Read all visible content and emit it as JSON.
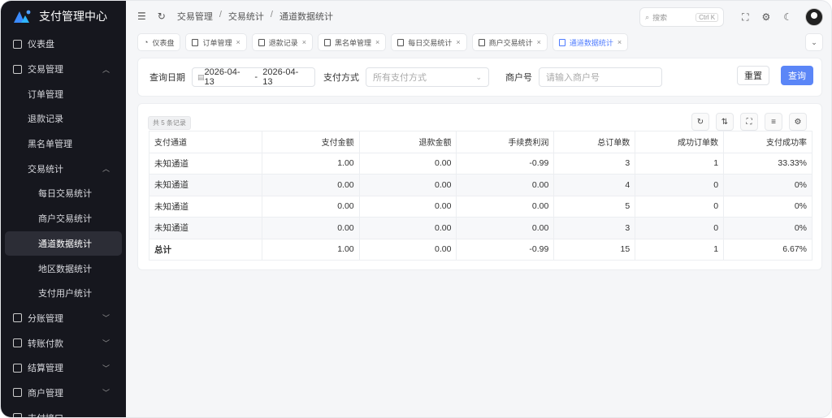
{
  "app": {
    "title": "支付管理中心"
  },
  "sidebar": {
    "items": [
      {
        "label": "仪表盘",
        "level": 1
      },
      {
        "label": "交易管理",
        "level": 1,
        "chev": "^"
      },
      {
        "label": "订单管理",
        "level": 2
      },
      {
        "label": "退款记录",
        "level": 2
      },
      {
        "label": "黑名单管理",
        "level": 2
      },
      {
        "label": "交易统计",
        "level": 2,
        "chev": "^"
      },
      {
        "label": "每日交易统计",
        "level": 3
      },
      {
        "label": "商户交易统计",
        "level": 3
      },
      {
        "label": "通道数据统计",
        "level": 3,
        "active": true
      },
      {
        "label": "地区数据统计",
        "level": 3
      },
      {
        "label": "支付用户统计",
        "level": 3
      },
      {
        "label": "分账管理",
        "level": 1,
        "chev": "v"
      },
      {
        "label": "转账付款",
        "level": 1,
        "chev": "v"
      },
      {
        "label": "结算管理",
        "level": 1,
        "chev": "v"
      },
      {
        "label": "商户管理",
        "level": 1,
        "chev": "v"
      },
      {
        "label": "支付接口",
        "level": 1
      }
    ]
  },
  "header": {
    "breadcrumb": [
      "交易管理",
      "交易统计",
      "通道数据统计"
    ],
    "search_placeholder": "搜索",
    "search_shortcut": "Ctrl K"
  },
  "tabs": [
    {
      "label": "仪表盘",
      "closable": false
    },
    {
      "label": "订单管理",
      "closable": true
    },
    {
      "label": "退款记录",
      "closable": true
    },
    {
      "label": "黑名单管理",
      "closable": true
    },
    {
      "label": "每日交易统计",
      "closable": true
    },
    {
      "label": "商户交易统计",
      "closable": true
    },
    {
      "label": "通道数据统计",
      "closable": true,
      "active": true
    }
  ],
  "filter": {
    "date_label": "查询日期",
    "date_start": "2026-04-13",
    "date_sep": "-",
    "date_end": "2026-04-13",
    "pay_label": "支付方式",
    "pay_placeholder": "所有支付方式",
    "merchant_label": "商户号",
    "merchant_placeholder": "请输入商户号",
    "reset": "重置",
    "query": "查询"
  },
  "table": {
    "count_text": "共 5 条记录",
    "columns": [
      "支付通道",
      "支付金额",
      "退款金额",
      "手续费利润",
      "总订单数",
      "成功订单数",
      "支付成功率"
    ],
    "rows": [
      [
        "未知通道",
        "1.00",
        "0.00",
        "-0.99",
        "3",
        "1",
        "33.33%"
      ],
      [
        "未知通道",
        "0.00",
        "0.00",
        "0.00",
        "4",
        "0",
        "0%"
      ],
      [
        "未知通道",
        "0.00",
        "0.00",
        "0.00",
        "5",
        "0",
        "0%"
      ],
      [
        "未知通道",
        "0.00",
        "0.00",
        "0.00",
        "3",
        "0",
        "0%"
      ]
    ],
    "total": [
      "总计",
      "1.00",
      "0.00",
      "-0.99",
      "15",
      "1",
      "6.67%"
    ]
  },
  "colors": {
    "accent": "#5b86f7",
    "sidebar": "#16171e"
  }
}
